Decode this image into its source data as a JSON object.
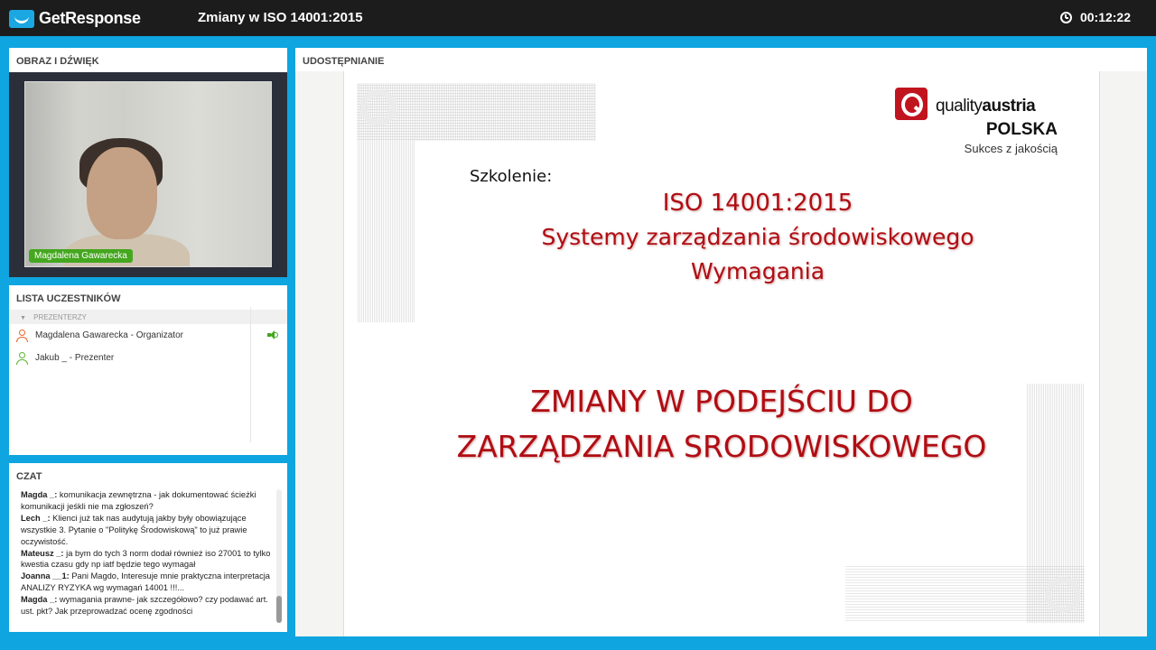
{
  "app": {
    "brand": "GetResponse",
    "webinar_title": "Zmiany w ISO 14001:2015",
    "timer": "00:12:22"
  },
  "video_panel": {
    "header": "OBRAZ I DŹWIĘK",
    "presenter_name": "Magdalena Gawarecka"
  },
  "participants_panel": {
    "header": "LISTA UCZESTNIKÓW",
    "group_label": "PREZENTERZY",
    "participants": [
      {
        "name": "Magdalena Gawarecka - Organizator",
        "speaking": true,
        "icon_color": "#e8662a"
      },
      {
        "name": "Jakub _ - Prezenter",
        "speaking": false,
        "icon_color": "#5bb52f"
      }
    ]
  },
  "chat_panel": {
    "header": "CZAT",
    "messages": [
      {
        "author": "Magda _:",
        "text": "komunikacja zewnętrzna - jak dokumentować ścieżki komunikacji jeśkli nie ma zgłoszeń?"
      },
      {
        "author": "Lech _:",
        "text": "Klienci już tak nas audytują jakby były obowiązujące wszystkie 3. Pytanie o \"Politykę Środowiskową\" to już prawie oczywistość."
      },
      {
        "author": "Mateusz _:",
        "text": "ja bym do tych 3 norm dodał również iso 27001 to tylko kwestia czasu gdy np iatf będzie tego wymagał"
      },
      {
        "author": "Joanna __1:",
        "text": "Pani Magdo, Interesuje mnie praktyczna interpretacja ANALIZY RYZYKA wg wymagań 14001 !!!..."
      },
      {
        "author": "Magda _:",
        "text": "wymagania prawne- jak szczegółowo? czy podawać art. ust. pkt? Jak przeprowadzać ocenę zgodności"
      }
    ]
  },
  "share_panel": {
    "header": "UDOSTĘPNIANIE",
    "slide": {
      "logo_brand_light": "quality",
      "logo_brand_bold": "austria",
      "logo_country": "POLSKA",
      "logo_tagline": "Sukces z jakością",
      "label": "Szkolenie:",
      "line1": "ISO 14001:2015",
      "line2": "Systemy zarządzania środowiskowego",
      "line3": "Wymagania",
      "headline1": "ZMIANY W PODEJŚCIU DO",
      "headline2": "ZARZĄDZANIA SRODOWISKOWEGO"
    }
  },
  "colors": {
    "background": "#0ea5e0",
    "topbar": "#1c1c1c",
    "accent_green": "#44a71f",
    "slide_red": "#b00d13",
    "brand_red": "#c0141e"
  }
}
